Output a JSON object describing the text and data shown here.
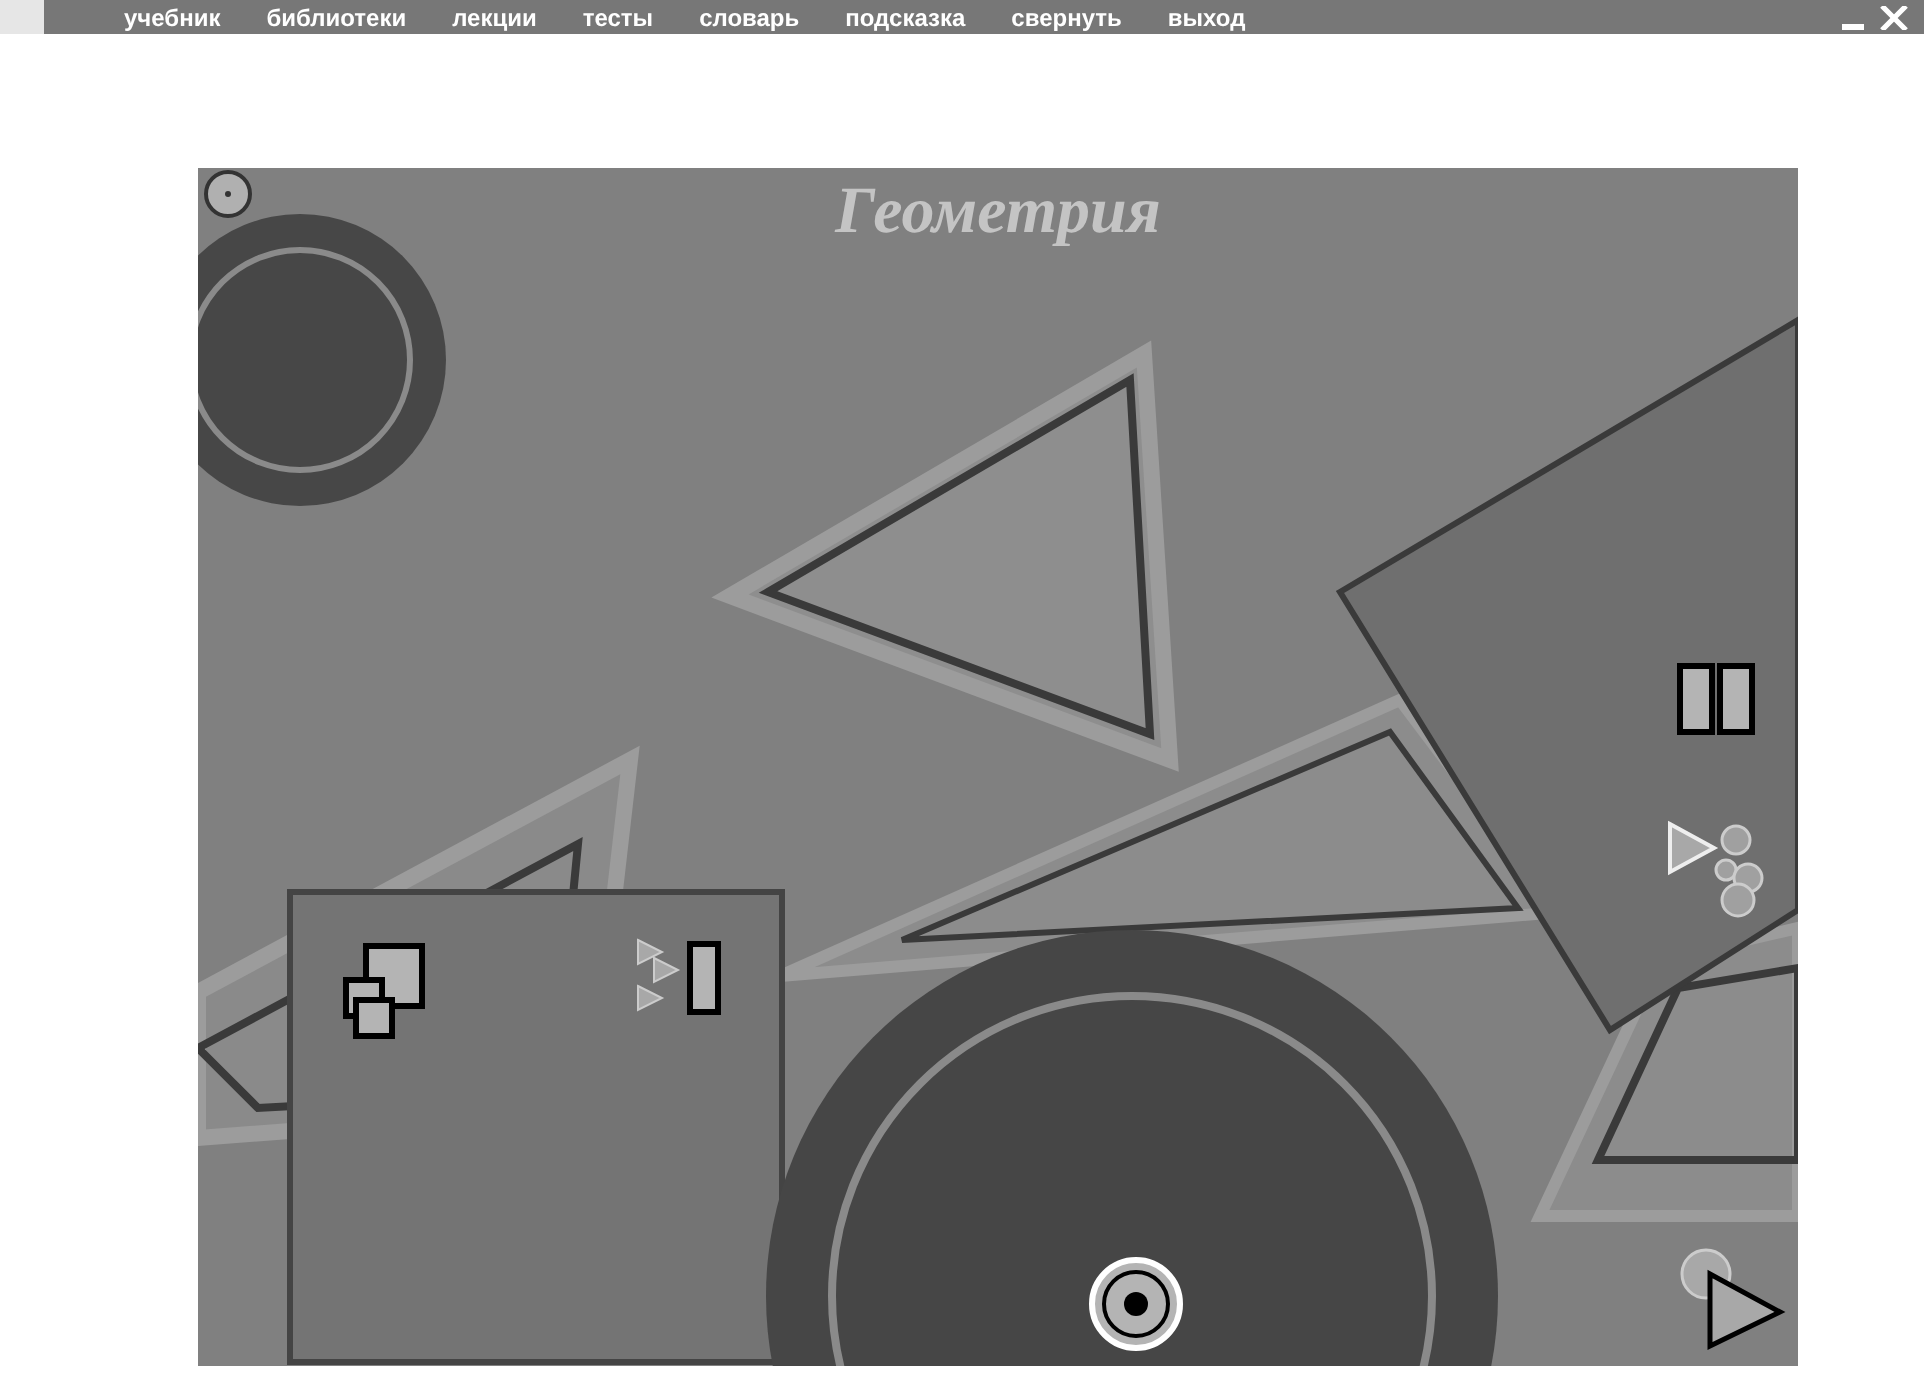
{
  "menu": [
    {
      "label": "учебник"
    },
    {
      "label": "библиотеки"
    },
    {
      "label": "лекции"
    },
    {
      "label": "тесты"
    },
    {
      "label": "словарь"
    },
    {
      "label": "подсказка"
    },
    {
      "label": "свернуть"
    },
    {
      "label": "выход"
    }
  ],
  "title": "Геометрия"
}
